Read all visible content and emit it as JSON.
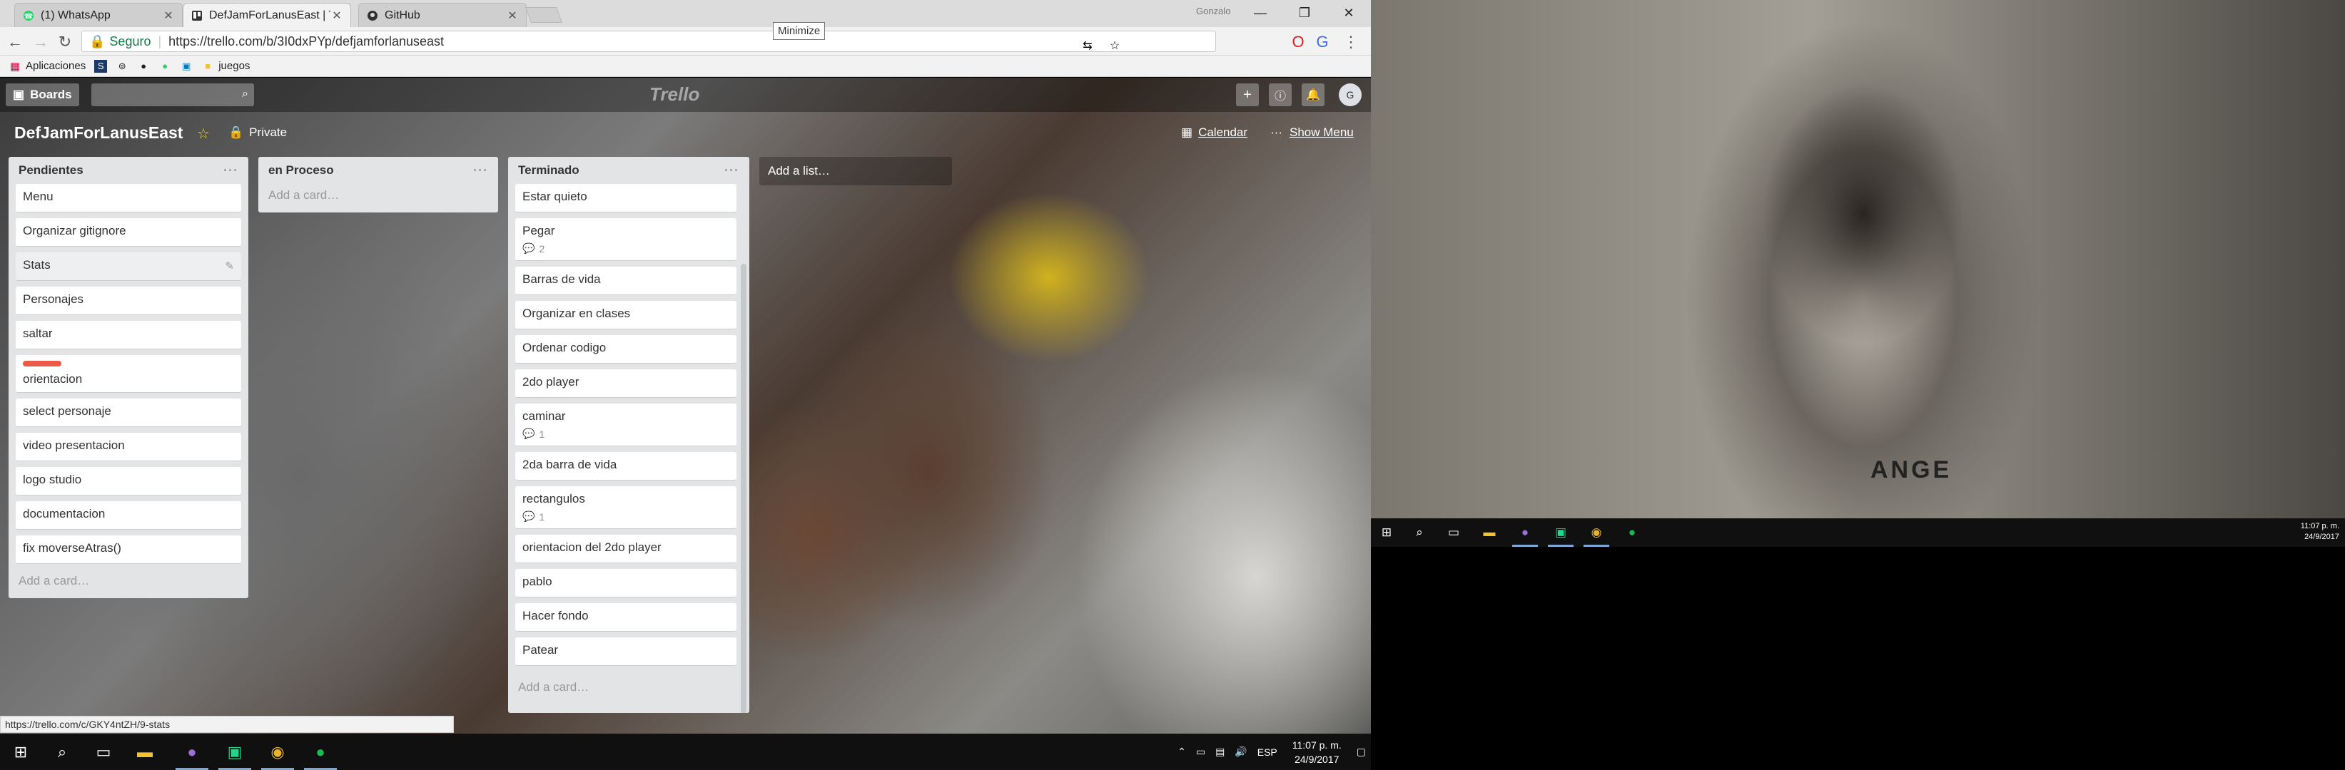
{
  "browser": {
    "tabs": [
      {
        "label": "(1) WhatsApp",
        "icon": "whatsapp-icon"
      },
      {
        "label": "DefJamForLanusEast | Tr",
        "icon": "trello-icon"
      },
      {
        "label": "GitHub",
        "icon": "github-icon"
      }
    ],
    "profile_name": "Gonzalo",
    "tooltip": "Minimize",
    "secure_label": "Seguro",
    "url": "https://trello.com/b/3I0dxPYp/defjamforlanuseast",
    "bookmarks": [
      {
        "label": "Aplicaciones",
        "icon": "apps-grid-icon"
      },
      {
        "label": "",
        "icon": "bookmark-icon"
      },
      {
        "label": "",
        "icon": "bookmark-icon"
      },
      {
        "label": "",
        "icon": "github-icon"
      },
      {
        "label": "",
        "icon": "whatsapp-icon"
      },
      {
        "label": "",
        "icon": "trello-icon"
      },
      {
        "label": "juegos",
        "icon": "folder-icon"
      }
    ],
    "status_url": "https://trello.com/c/GKY4ntZH/9-stats"
  },
  "trello": {
    "boards_label": "Boards",
    "logo_text": "Trello",
    "avatar_initial": "G",
    "board_title": "DefJamForLanusEast",
    "privacy": "Private",
    "calendar": "Calendar",
    "show_menu": "Show Menu",
    "add_list": "Add a list…",
    "lists": [
      {
        "title": "Pendientes",
        "add_card": "Add a card…",
        "cards": [
          {
            "text": "Menu"
          },
          {
            "text": "Organizar gitignore"
          },
          {
            "text": "Stats"
          },
          {
            "text": "Personajes"
          },
          {
            "text": "saltar"
          },
          {
            "text": "orientacion",
            "label_color": "#eb5a46"
          },
          {
            "text": "select personaje"
          },
          {
            "text": "video presentacion"
          },
          {
            "text": "logo studio"
          },
          {
            "text": "documentacion"
          },
          {
            "text": "fix moverseAtras()"
          }
        ]
      },
      {
        "title": "en Proceso",
        "add_card": "Add a card…",
        "cards": []
      },
      {
        "title": "Terminado",
        "add_card": "Add a card…",
        "cards": [
          {
            "text": "Estar quieto"
          },
          {
            "text": "Pegar",
            "comments": "2"
          },
          {
            "text": "Barras de vida"
          },
          {
            "text": "Organizar en clases"
          },
          {
            "text": "Ordenar codigo"
          },
          {
            "text": "2do player"
          },
          {
            "text": "caminar",
            "comments": "1"
          },
          {
            "text": "2da barra de vida"
          },
          {
            "text": "rectangulos",
            "comments": "1"
          },
          {
            "text": "orientacion del 2do player"
          },
          {
            "text": "pablo"
          },
          {
            "text": "Hacer fondo"
          },
          {
            "text": "Patear"
          }
        ]
      }
    ]
  },
  "taskbar": {
    "items": [
      {
        "icon": "windows-start-icon"
      },
      {
        "icon": "search-icon"
      },
      {
        "icon": "task-view-icon"
      },
      {
        "icon": "file-explorer-icon"
      },
      {
        "icon": "github-desktop-icon"
      },
      {
        "icon": "pycharm-icon"
      },
      {
        "icon": "chrome-icon"
      },
      {
        "icon": "spotify-icon"
      }
    ],
    "language": "ESP",
    "time": "11:07 p. m.",
    "date": "24/9/2017"
  },
  "monitor2": {
    "wallpaper_text": "ANGE",
    "time": "11:07 p. m.",
    "date": "24/9/2017"
  }
}
